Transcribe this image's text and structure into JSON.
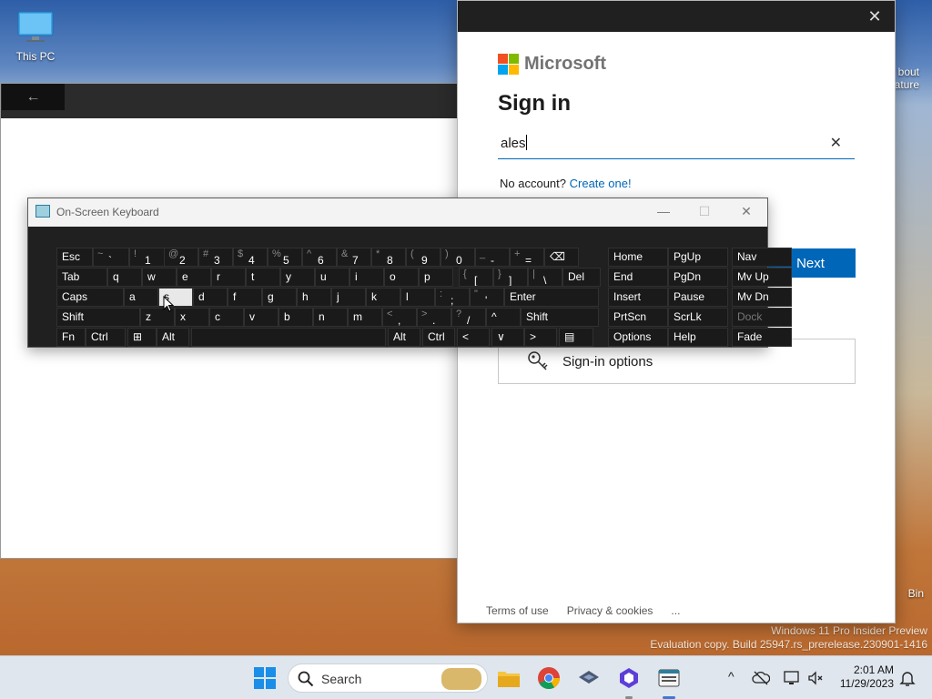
{
  "desktop": {
    "this_pc_label": "This PC",
    "about_feature_label": "bout\nature",
    "recycle_bin_label": "Bin",
    "watermark_line1": "Windows 11 Pro Insider Preview",
    "watermark_line2": "Evaluation copy. Build 25947.rs_prerelease.230901-1416"
  },
  "background_app": {
    "back_glyph": "←"
  },
  "signin": {
    "close_glyph": "✕",
    "brand": "Microsoft",
    "title": "Sign in",
    "email_value": "ales",
    "clear_glyph": "✕",
    "no_account_text": "No account?",
    "create_link": "Create one!",
    "next_label": "Next",
    "options_label": "Sign-in options",
    "footer_terms": "Terms of use",
    "footer_privacy": "Privacy & cookies",
    "footer_more": "...",
    "logo_colors": [
      "#f25022",
      "#7fba00",
      "#00a4ef",
      "#ffb900"
    ],
    "accent": "#0067b8"
  },
  "osk": {
    "title": "On-Screen Keyboard",
    "min_glyph": "—",
    "max_glyph": "☐",
    "close_glyph": "✕",
    "rows": [
      [
        {
          "label": "Esc"
        },
        {
          "shift": "~",
          "ch": "`"
        },
        {
          "shift": "!",
          "ch": "1"
        },
        {
          "shift": "@",
          "ch": "2"
        },
        {
          "shift": "#",
          "ch": "3"
        },
        {
          "shift": "$",
          "ch": "4"
        },
        {
          "shift": "%",
          "ch": "5"
        },
        {
          "shift": "^",
          "ch": "6"
        },
        {
          "shift": "&",
          "ch": "7"
        },
        {
          "shift": "*",
          "ch": "8"
        },
        {
          "shift": "(",
          "ch": "9"
        },
        {
          "shift": ")",
          "ch": "0"
        },
        {
          "shift": "_",
          "ch": "-"
        },
        {
          "shift": "+",
          "ch": "="
        },
        {
          "label": "⌫"
        },
        {
          "label": "Home"
        },
        {
          "label": "PgUp"
        },
        {
          "label": "Nav"
        }
      ],
      [
        {
          "label": "Tab"
        },
        {
          "label": "q"
        },
        {
          "label": "w"
        },
        {
          "label": "e"
        },
        {
          "label": "r"
        },
        {
          "label": "t"
        },
        {
          "label": "y"
        },
        {
          "label": "u"
        },
        {
          "label": "i"
        },
        {
          "label": "o"
        },
        {
          "label": "p"
        },
        {
          "shift": "{",
          "ch": "["
        },
        {
          "shift": "}",
          "ch": "]"
        },
        {
          "shift": "|",
          "ch": "\\"
        },
        {
          "label": "Del"
        },
        {
          "label": "End"
        },
        {
          "label": "PgDn"
        },
        {
          "label": "Mv Up"
        }
      ],
      [
        {
          "label": "Caps"
        },
        {
          "label": "a"
        },
        {
          "label": "s",
          "active": true
        },
        {
          "label": "d"
        },
        {
          "label": "f"
        },
        {
          "label": "g"
        },
        {
          "label": "h"
        },
        {
          "label": "j"
        },
        {
          "label": "k"
        },
        {
          "label": "l"
        },
        {
          "shift": ":",
          "ch": ";"
        },
        {
          "shift": "\"",
          "ch": "'"
        },
        {
          "label": "Enter"
        },
        {
          "label": "Insert"
        },
        {
          "label": "Pause"
        },
        {
          "label": "Mv Dn"
        }
      ],
      [
        {
          "label": "Shift"
        },
        {
          "label": "z"
        },
        {
          "label": "x"
        },
        {
          "label": "c"
        },
        {
          "label": "v"
        },
        {
          "label": "b"
        },
        {
          "label": "n"
        },
        {
          "label": "m"
        },
        {
          "shift": "<",
          "ch": ","
        },
        {
          "shift": ">",
          "ch": "."
        },
        {
          "shift": "?",
          "ch": "/"
        },
        {
          "label": "^"
        },
        {
          "label": "Shift"
        },
        {
          "label": "PrtScn"
        },
        {
          "label": "ScrLk"
        },
        {
          "label": "Dock",
          "dim": true
        }
      ],
      [
        {
          "label": "Fn"
        },
        {
          "label": "Ctrl"
        },
        {
          "label": "⊞"
        },
        {
          "label": "Alt"
        },
        {
          "label": ""
        },
        {
          "label": "Alt"
        },
        {
          "label": "Ctrl"
        },
        {
          "label": "<"
        },
        {
          "label": "∨"
        },
        {
          "label": ">"
        },
        {
          "label": "▤"
        },
        {
          "label": "Options"
        },
        {
          "label": "Help"
        },
        {
          "label": "Fade"
        }
      ]
    ]
  },
  "taskbar": {
    "search_label": "Search",
    "tray_chevron": "^",
    "time": "2:01 AM",
    "date": "11/29/2023"
  }
}
